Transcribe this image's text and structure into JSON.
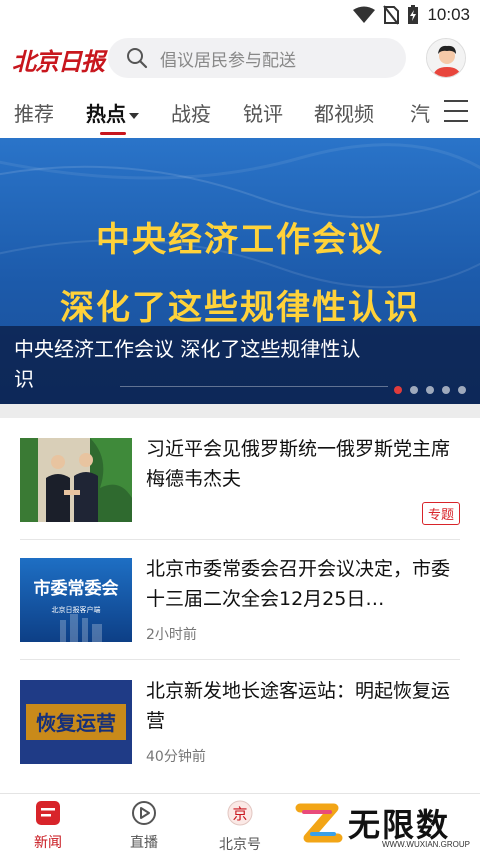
{
  "status_bar": {
    "time": "10:03",
    "icons": [
      "wifi-icon",
      "no-sim-icon",
      "battery-charging-icon"
    ]
  },
  "header": {
    "logo_text": "北京日报",
    "search_placeholder": "倡议居民参与配送",
    "avatar_icon": "user-avatar-icon"
  },
  "tabs": [
    {
      "label": "推荐"
    },
    {
      "label": "热点",
      "active": true
    },
    {
      "label": "战疫"
    },
    {
      "label": "锐评"
    },
    {
      "label": "都视频"
    },
    {
      "label": "汽"
    }
  ],
  "banner": {
    "headline_line1": "中央经济工作会议",
    "headline_line2": "深化了这些规律性认识",
    "caption": "中央经济工作会议 深化了这些规律性认识",
    "slides_total": 5,
    "slide_active": 1
  },
  "news": [
    {
      "title": "习近平会见俄罗斯统一俄罗斯党主席梅德韦杰夫",
      "tag": "专题",
      "time": ""
    },
    {
      "title": "北京市委常委会召开会议决定，市委十三届二次全会12月25日…",
      "time": "2小时前",
      "thumb_text": "市委常委会",
      "thumb_sub": "北京日报客户端"
    },
    {
      "title": "北京新发地长途客运站：明起恢复运营",
      "time": "40分钟前",
      "thumb_text": "恢复运营"
    }
  ],
  "bottom_nav": [
    {
      "label": "新闻",
      "icon": "news-icon",
      "active": true
    },
    {
      "label": "直播",
      "icon": "play-circle-icon"
    },
    {
      "label": "北京号",
      "icon": "beijing-hao-icon"
    }
  ],
  "watermark": {
    "text": "无限数码",
    "sub": "WWW.WUXIAN.GROUP"
  },
  "colors": {
    "brand_red": "#c8161d",
    "banner_blue": "#1c5aaa",
    "banner_yellow": "#ffd23a"
  }
}
